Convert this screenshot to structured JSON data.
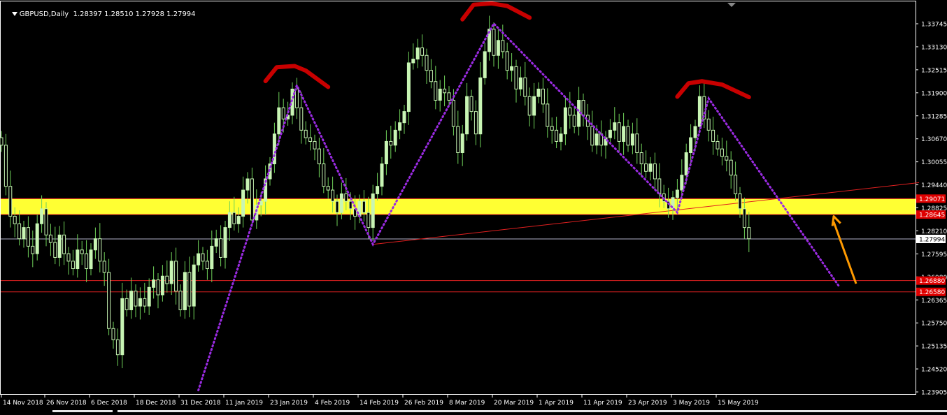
{
  "header": {
    "symbol_timeframe": "GBPUSD,Daily",
    "ohlc": "1.28397 1.28510 1.27928 1.27994"
  },
  "colors": {
    "background": "#000000",
    "frame": "#ffffff",
    "bull_candle": "#c8f5b4",
    "bear_candle": "#000000",
    "wick": "#70d25a",
    "zone_fill": "#ffff33",
    "level_line": "#e02020",
    "price_line": "#b0b0c8",
    "dotted_line": "#9a2be2",
    "arc": "#c80000",
    "arrow": "#ff9a00",
    "label_red_bg": "#e00000"
  },
  "chart_data": {
    "type": "candlestick",
    "symbol": "GBPUSD",
    "timeframe": "Daily",
    "y_ticks": [
      "1.33745",
      "1.33130",
      "1.32515",
      "1.31900",
      "1.31285",
      "1.30670",
      "1.30055",
      "1.29440",
      "1.28825",
      "1.28210",
      "1.27595",
      "1.26980",
      "1.26365",
      "1.25750",
      "1.25135",
      "1.24520",
      "1.23905"
    ],
    "ylim": [
      1.2385,
      1.34
    ],
    "x_tick_labels": [
      "14 Nov 2018",
      "26 Nov 2018",
      "6 Dec 2018",
      "18 Dec 2018",
      "31 Dec 2018",
      "11 Jan 2019",
      "23 Jan 2019",
      "4 Feb 2019",
      "14 Feb 2019",
      "26 Feb 2019",
      "8 Mar 2019",
      "20 Mar 2019",
      "1 Apr 2019",
      "11 Apr 2019",
      "23 Apr 2019",
      "3 May 2019",
      "15 May 2019"
    ],
    "current_price": "1.27994",
    "price_tags": [
      {
        "text": "1.29071",
        "style": "red"
      },
      {
        "text": "1.28645",
        "style": "red"
      },
      {
        "text": "1.27994",
        "style": "current"
      },
      {
        "text": "1.26880",
        "style": "red"
      },
      {
        "text": "1.26580",
        "style": "red"
      }
    ],
    "horizontal_levels": [
      1.29071,
      1.28645,
      1.2688,
      1.2658
    ],
    "current_price_line": 1.27994,
    "support_zone": [
      1.28645,
      1.29071
    ],
    "closes": [
      1.305,
      1.294,
      1.286,
      1.284,
      1.28,
      1.283,
      1.278,
      1.276,
      1.284,
      1.288,
      1.281,
      1.279,
      1.275,
      1.281,
      1.276,
      1.274,
      1.272,
      1.277,
      1.276,
      1.272,
      1.277,
      1.28,
      1.274,
      1.271,
      1.256,
      1.253,
      1.249,
      1.264,
      1.261,
      1.266,
      1.262,
      1.264,
      1.262,
      1.267,
      1.269,
      1.265,
      1.27,
      1.268,
      1.274,
      1.266,
      1.261,
      1.271,
      1.262,
      1.273,
      1.276,
      1.274,
      1.272,
      1.278,
      1.28,
      1.275,
      1.283,
      1.287,
      1.284,
      1.286,
      1.293,
      1.296,
      1.285,
      1.289,
      1.29,
      1.296,
      1.3,
      1.308,
      1.315,
      1.312,
      1.313,
      1.32,
      1.315,
      1.309,
      1.307,
      1.306,
      1.304,
      1.3,
      1.294,
      1.293,
      1.29,
      1.287,
      1.292,
      1.29,
      1.288,
      1.286,
      1.29,
      1.287,
      1.283,
      1.292,
      1.294,
      1.3,
      1.306,
      1.305,
      1.309,
      1.311,
      1.314,
      1.327,
      1.328,
      1.331,
      1.329,
      1.325,
      1.322,
      1.317,
      1.32,
      1.319,
      1.317,
      1.31,
      1.303,
      1.308,
      1.318,
      1.314,
      1.308,
      1.323,
      1.33,
      1.336,
      1.329,
      1.333,
      1.33,
      1.325,
      1.326,
      1.32,
      1.323,
      1.318,
      1.313,
      1.318,
      1.32,
      1.316,
      1.31,
      1.309,
      1.306,
      1.308,
      1.315,
      1.313,
      1.31,
      1.317,
      1.313,
      1.31,
      1.305,
      1.308,
      1.305,
      1.307,
      1.309,
      1.311,
      1.306,
      1.31,
      1.305,
      1.308,
      1.303,
      1.3,
      1.298,
      1.3,
      1.296,
      1.292,
      1.29,
      1.288,
      1.291,
      1.293,
      1.297,
      1.303,
      1.307,
      1.31,
      1.318,
      1.312,
      1.309,
      1.306,
      1.304,
      1.302,
      1.301,
      1.297,
      1.292,
      1.288,
      1.283,
      1.28
    ],
    "patterns": [
      {
        "label": "head-and-shoulders-top",
        "swings": [
          {
            "idx": 44,
            "price": 1.2395
          },
          {
            "idx": 66,
            "price": 1.321
          },
          {
            "idx": 83,
            "price": 1.2785
          },
          {
            "idx": 110,
            "price": 1.3375
          },
          {
            "idx": 151,
            "price": 1.287
          },
          {
            "idx": 158,
            "price": 1.3175
          },
          {
            "idx": 187,
            "price": 1.2675
          }
        ]
      }
    ],
    "neckline": {
      "from": {
        "idx": 83,
        "price": 1.2785
      },
      "to": {
        "idx": 205,
        "price": 1.295
      }
    },
    "projection_arrow": {
      "from": {
        "idx": 190,
        "price": 1.268
      },
      "to": {
        "idx": 185,
        "price": 1.286
      }
    }
  }
}
